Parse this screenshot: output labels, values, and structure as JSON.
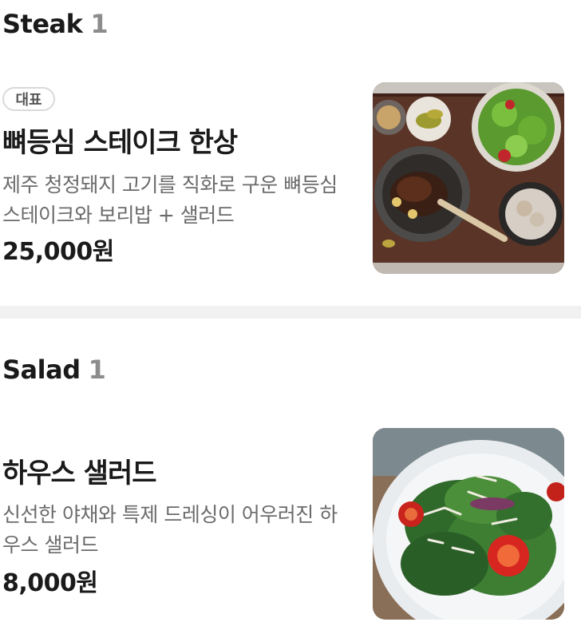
{
  "sections": [
    {
      "title": "Steak",
      "count": "1",
      "items": [
        {
          "badge": "대표",
          "name": "뼈등심 스테이크 한상",
          "description": "제주 청정돼지 고기를 직화로 구운 뼈등심 스테이크와 보리밥 + 샐러드",
          "price": "25,000원",
          "image": "steak-set-photo"
        }
      ]
    },
    {
      "title": "Salad",
      "count": "1",
      "items": [
        {
          "name": "하우스 샐러드",
          "description": "신선한 야채와 특제 드레싱이 어우러진 하우스 샐러드",
          "price": "8,000원",
          "image": "house-salad-photo"
        }
      ]
    }
  ],
  "colors": {
    "text": "#1a1a1a",
    "muted": "#6b6b6b",
    "count": "#8c8c8c",
    "divider": "#f1f1f1",
    "badge_border": "#d9d9d9"
  }
}
